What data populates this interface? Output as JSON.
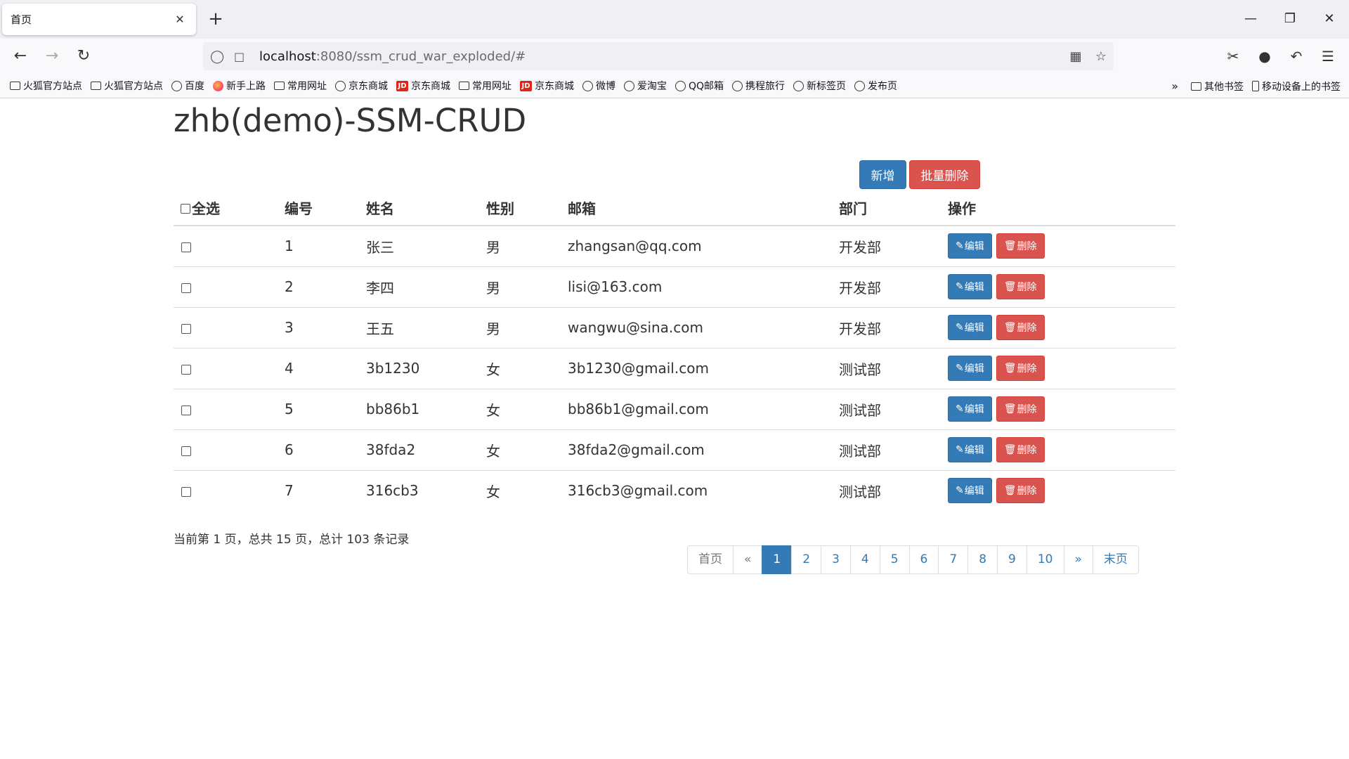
{
  "browser": {
    "tab_title": "首页",
    "tab_close": "✕",
    "new_tab": "+",
    "url_host": "localhost",
    "url_rest": ":8080/ssm_crud_war_exploded/#",
    "bookmarks": [
      {
        "label": "火狐官方站点",
        "icon": "folder"
      },
      {
        "label": "火狐官方站点",
        "icon": "folder"
      },
      {
        "label": "百度",
        "icon": "globe"
      },
      {
        "label": "新手上路",
        "icon": "firefox"
      },
      {
        "label": "常用网址",
        "icon": "folder"
      },
      {
        "label": "京东商城",
        "icon": "globe"
      },
      {
        "label": "京东商城",
        "icon": "jd"
      },
      {
        "label": "常用网址",
        "icon": "folder"
      },
      {
        "label": "京东商城",
        "icon": "jd"
      },
      {
        "label": "微博",
        "icon": "globe"
      },
      {
        "label": "爱淘宝",
        "icon": "globe"
      },
      {
        "label": "QQ邮箱",
        "icon": "globe"
      },
      {
        "label": "携程旅行",
        "icon": "globe"
      },
      {
        "label": "新标签页",
        "icon": "globe"
      },
      {
        "label": "发布页",
        "icon": "globe"
      }
    ],
    "other_bookmarks": "其他书签",
    "mobile_bookmarks": "移动设备上的书签"
  },
  "page": {
    "title": "zhb(demo)-SSM-CRUD",
    "add_button": "新增",
    "batch_delete_button": "批量删除",
    "columns": [
      "全选",
      "编号",
      "姓名",
      "性别",
      "邮箱",
      "部门",
      "操作"
    ],
    "rows": [
      {
        "id": "1",
        "name": "张三",
        "gender": "男",
        "email": "zhangsan@qq.com",
        "dept": "开发部"
      },
      {
        "id": "2",
        "name": "李四",
        "gender": "男",
        "email": "lisi@163.com",
        "dept": "开发部"
      },
      {
        "id": "3",
        "name": "王五",
        "gender": "男",
        "email": "wangwu@sina.com",
        "dept": "开发部"
      },
      {
        "id": "4",
        "name": "3b1230",
        "gender": "女",
        "email": "3b1230@gmail.com",
        "dept": "测试部"
      },
      {
        "id": "5",
        "name": "bb86b1",
        "gender": "女",
        "email": "bb86b1@gmail.com",
        "dept": "测试部"
      },
      {
        "id": "6",
        "name": "38fda2",
        "gender": "女",
        "email": "38fda2@gmail.com",
        "dept": "测试部"
      },
      {
        "id": "7",
        "name": "316cb3",
        "gender": "女",
        "email": "316cb3@gmail.com",
        "dept": "测试部"
      }
    ],
    "edit_label": "编辑",
    "delete_label": "删除",
    "page_info": "当前第 1 页，总共 15 页，总计 103 条记录",
    "pagination": {
      "first": "首页",
      "prev": "«",
      "pages": [
        "1",
        "2",
        "3",
        "4",
        "5",
        "6",
        "7",
        "8",
        "9",
        "10"
      ],
      "current": "1",
      "next": "»",
      "last": "末页"
    }
  },
  "colors": {
    "primary": "#337ab7",
    "danger": "#d9534f"
  }
}
